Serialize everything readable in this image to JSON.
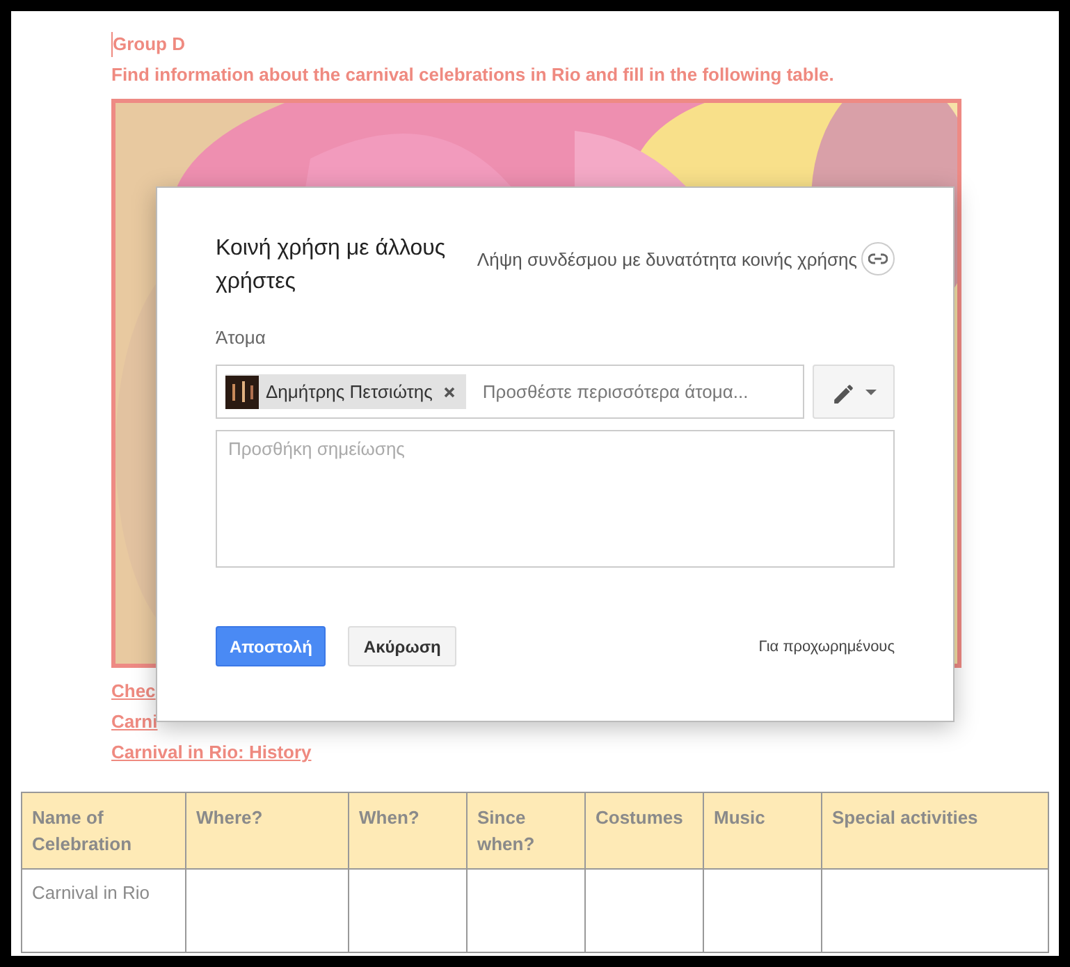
{
  "document": {
    "heading": "Group D",
    "instruction": "Find information about the carnival celebrations in Rio and fill in the following table.",
    "links": [
      "Chec",
      "Carni",
      "Carnival in Rio: History"
    ]
  },
  "table": {
    "columns": [
      "Name of Celebration",
      "Where?",
      "When?",
      "Since when?",
      "Costumes",
      "Music",
      "Special activities"
    ],
    "rows": [
      {
        "cells": [
          "Carnival in Rio"
        ]
      }
    ]
  },
  "dialog": {
    "title": "Κοινή χρήση με άλλους χρήστες",
    "share_link_label": "Λήψη συνδέσμου με δυνατότητα κοινής χρήσης",
    "people_label": "Άτομα",
    "recipients": [
      {
        "name": "Δημήτρης Πετσιώτης"
      }
    ],
    "add_placeholder": "Προσθέστε περισσότερα άτομα...",
    "note_placeholder": "Προσθήκη σημείωσης",
    "send_button": "Αποστολή",
    "cancel_button": "Ακύρωση",
    "advanced_link": "Για προχωρημένους"
  }
}
